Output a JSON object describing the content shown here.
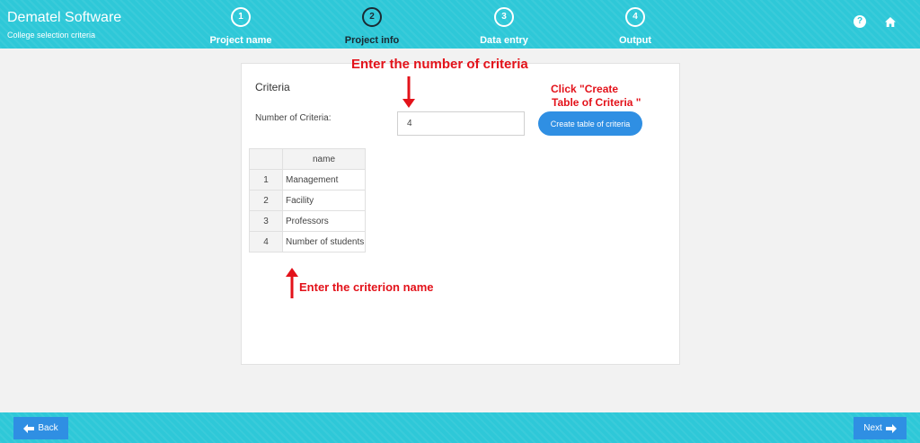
{
  "header": {
    "app_title": "Dematel Software",
    "subtitle": "College selection criteria",
    "steps": [
      {
        "number": "1",
        "label": "Project name"
      },
      {
        "number": "2",
        "label": "Project info",
        "active": true
      },
      {
        "number": "3",
        "label": "Data entry"
      },
      {
        "number": "4",
        "label": "Output"
      }
    ],
    "help_glyph": "?",
    "icons": [
      "help-icon",
      "home-icon"
    ]
  },
  "card": {
    "title": "Criteria",
    "number_label": "Number of Criteria:",
    "number_value": "4",
    "create_button": "Create table of criteria",
    "table": {
      "headers": [
        "",
        "name"
      ],
      "rows": [
        {
          "index": "1",
          "name": "Management"
        },
        {
          "index": "2",
          "name": "Facility"
        },
        {
          "index": "3",
          "name": "Professors"
        },
        {
          "index": "4",
          "name": "Number of students"
        }
      ]
    }
  },
  "annotations": {
    "enter_number": "Enter the number of criteria",
    "click_create_line1": "Click \"Create",
    "click_create_line2": "Table of Criteria \"",
    "enter_name": "Enter the criterion name"
  },
  "footer": {
    "back_label": "Back",
    "next_label": "Next"
  },
  "colors": {
    "header_bg": "#2ec8d8",
    "button_blue": "#2f8fe3",
    "annotation_red": "#e3121a",
    "active_step": "#1a2a33"
  }
}
